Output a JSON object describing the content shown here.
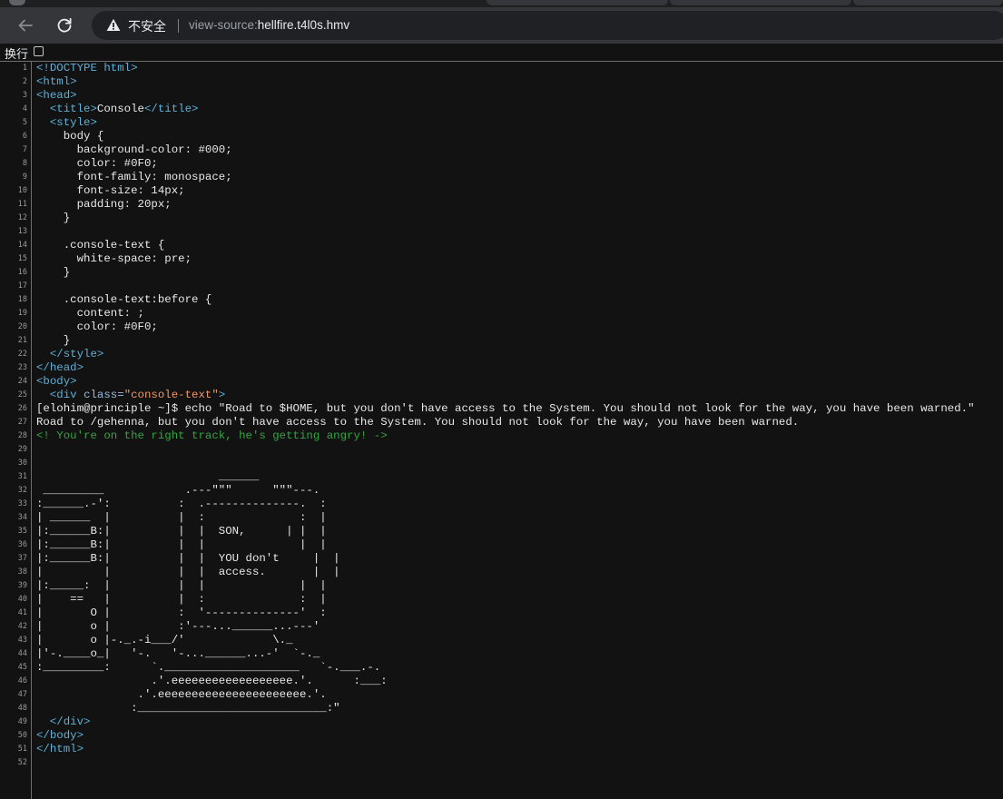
{
  "browser": {
    "security_label": "不安全",
    "url_scheme": "view-source:",
    "url_host": "hellfire.t4l0s.hmv",
    "icons": [
      "back-arrow-icon",
      "reload-icon",
      "warning-triangle-icon"
    ]
  },
  "toolbar": {
    "wrap_label": "换行",
    "wrap_checked": false
  },
  "source_lines": [
    {
      "n": "1",
      "parts": [
        {
          "c": "tag",
          "t": "<!DOCTYPE html>"
        }
      ]
    },
    {
      "n": "2",
      "parts": [
        {
          "c": "tag",
          "t": "<html>"
        }
      ]
    },
    {
      "n": "3",
      "parts": [
        {
          "c": "tag",
          "t": "<head>"
        }
      ]
    },
    {
      "n": "4",
      "parts": [
        {
          "c": "tag",
          "t": "  <title>"
        },
        {
          "c": "plain",
          "t": "Console"
        },
        {
          "c": "tag",
          "t": "</title>"
        }
      ]
    },
    {
      "n": "5",
      "parts": [
        {
          "c": "tag",
          "t": "  <style>"
        }
      ]
    },
    {
      "n": "6",
      "parts": [
        {
          "c": "plain",
          "t": "    body {"
        }
      ]
    },
    {
      "n": "7",
      "parts": [
        {
          "c": "plain",
          "t": "      background-color: #000;"
        }
      ]
    },
    {
      "n": "8",
      "parts": [
        {
          "c": "plain",
          "t": "      color: #0F0;"
        }
      ]
    },
    {
      "n": "9",
      "parts": [
        {
          "c": "plain",
          "t": "      font-family: monospace;"
        }
      ]
    },
    {
      "n": "10",
      "parts": [
        {
          "c": "plain",
          "t": "      font-size: 14px;"
        }
      ]
    },
    {
      "n": "11",
      "parts": [
        {
          "c": "plain",
          "t": "      padding: 20px;"
        }
      ]
    },
    {
      "n": "12",
      "parts": [
        {
          "c": "plain",
          "t": "    }"
        }
      ]
    },
    {
      "n": "13",
      "parts": [
        {
          "c": "plain",
          "t": ""
        }
      ]
    },
    {
      "n": "14",
      "parts": [
        {
          "c": "plain",
          "t": "    .console-text {"
        }
      ]
    },
    {
      "n": "15",
      "parts": [
        {
          "c": "plain",
          "t": "      white-space: pre;"
        }
      ]
    },
    {
      "n": "16",
      "parts": [
        {
          "c": "plain",
          "t": "    }"
        }
      ]
    },
    {
      "n": "17",
      "parts": [
        {
          "c": "plain",
          "t": ""
        }
      ]
    },
    {
      "n": "18",
      "parts": [
        {
          "c": "plain",
          "t": "    .console-text:before {"
        }
      ]
    },
    {
      "n": "19",
      "parts": [
        {
          "c": "plain",
          "t": "      content: ;"
        }
      ]
    },
    {
      "n": "20",
      "parts": [
        {
          "c": "plain",
          "t": "      color: #0F0;"
        }
      ]
    },
    {
      "n": "21",
      "parts": [
        {
          "c": "plain",
          "t": "    }"
        }
      ]
    },
    {
      "n": "22",
      "parts": [
        {
          "c": "tag",
          "t": "  </style>"
        }
      ]
    },
    {
      "n": "23",
      "parts": [
        {
          "c": "tag",
          "t": "</head>"
        }
      ]
    },
    {
      "n": "24",
      "parts": [
        {
          "c": "tag",
          "t": "<body>"
        }
      ]
    },
    {
      "n": "25",
      "parts": [
        {
          "c": "tag",
          "t": "  <div "
        },
        {
          "c": "attr",
          "t": "class="
        },
        {
          "c": "val",
          "t": "\"console-text\""
        },
        {
          "c": "tag",
          "t": ">"
        }
      ]
    },
    {
      "n": "26",
      "parts": [
        {
          "c": "plain",
          "t": "[elohim@principle ~]$ echo \"Road to $HOME, but you don't have access to the System. You should not look for the way, you have been warned.\""
        }
      ]
    },
    {
      "n": "27",
      "parts": [
        {
          "c": "plain",
          "t": "Road to /gehenna, but you don't have access to the System. You should not look for the way, you have been warned."
        }
      ]
    },
    {
      "n": "28",
      "parts": [
        {
          "c": "cmt",
          "t": "<! You're on the right track, he's getting angry! ->"
        }
      ]
    },
    {
      "n": "29",
      "parts": [
        {
          "c": "plain",
          "t": ""
        }
      ]
    },
    {
      "n": "30",
      "parts": [
        {
          "c": "plain",
          "t": ""
        }
      ]
    },
    {
      "n": "31",
      "parts": [
        {
          "c": "plain",
          "t": "                           ______"
        }
      ]
    },
    {
      "n": "32",
      "parts": [
        {
          "c": "plain",
          "t": " _________            .---\"\"\"      \"\"\"---."
        }
      ]
    },
    {
      "n": "33",
      "parts": [
        {
          "c": "plain",
          "t": ":______.-':          :  .--------------.  :"
        }
      ]
    },
    {
      "n": "34",
      "parts": [
        {
          "c": "plain",
          "t": "| ______  |          |  :              :  |"
        }
      ]
    },
    {
      "n": "35",
      "parts": [
        {
          "c": "plain",
          "t": "|:______B:|          |  |  SON,      | |  |"
        }
      ]
    },
    {
      "n": "36",
      "parts": [
        {
          "c": "plain",
          "t": "|:______B:|          |  |              |  |"
        }
      ]
    },
    {
      "n": "37",
      "parts": [
        {
          "c": "plain",
          "t": "|:______B:|          |  |  YOU don't     |  |"
        }
      ]
    },
    {
      "n": "38",
      "parts": [
        {
          "c": "plain",
          "t": "|         |          |  |  access.       |  |"
        }
      ]
    },
    {
      "n": "39",
      "parts": [
        {
          "c": "plain",
          "t": "|:_____:  |          |  |              |  |"
        }
      ]
    },
    {
      "n": "40",
      "parts": [
        {
          "c": "plain",
          "t": "|    ==   |          |  :              :  |"
        }
      ]
    },
    {
      "n": "41",
      "parts": [
        {
          "c": "plain",
          "t": "|       O |          :  '--------------'  :"
        }
      ]
    },
    {
      "n": "42",
      "parts": [
        {
          "c": "plain",
          "t": "|       o |          :'---...______...---'"
        }
      ]
    },
    {
      "n": "43",
      "parts": [
        {
          "c": "plain",
          "t": "|       o |-._.-i___/'             \\._"
        }
      ]
    },
    {
      "n": "44",
      "parts": [
        {
          "c": "plain",
          "t": "|'-.____o_|   '-.   '-...______...-'  `-._"
        }
      ]
    },
    {
      "n": "45",
      "parts": [
        {
          "c": "plain",
          "t": ":_________:      `.____________________   `-.___.-."
        }
      ]
    },
    {
      "n": "46",
      "parts": [
        {
          "c": "plain",
          "t": "                 .'.eeeeeeeeeeeeeeeeee.'.      :___:"
        }
      ]
    },
    {
      "n": "47",
      "parts": [
        {
          "c": "plain",
          "t": "               .'.eeeeeeeeeeeeeeeeeeeeee.'."
        }
      ]
    },
    {
      "n": "48",
      "parts": [
        {
          "c": "plain",
          "t": "              :____________________________:\""
        }
      ]
    },
    {
      "n": "49",
      "parts": [
        {
          "c": "tag",
          "t": "  </div>"
        }
      ]
    },
    {
      "n": "50",
      "parts": [
        {
          "c": "tag",
          "t": "</body>"
        }
      ]
    },
    {
      "n": "51",
      "parts": [
        {
          "c": "tag",
          "t": "</html>"
        }
      ]
    },
    {
      "n": "52",
      "parts": [
        {
          "c": "plain",
          "t": ""
        }
      ]
    }
  ]
}
